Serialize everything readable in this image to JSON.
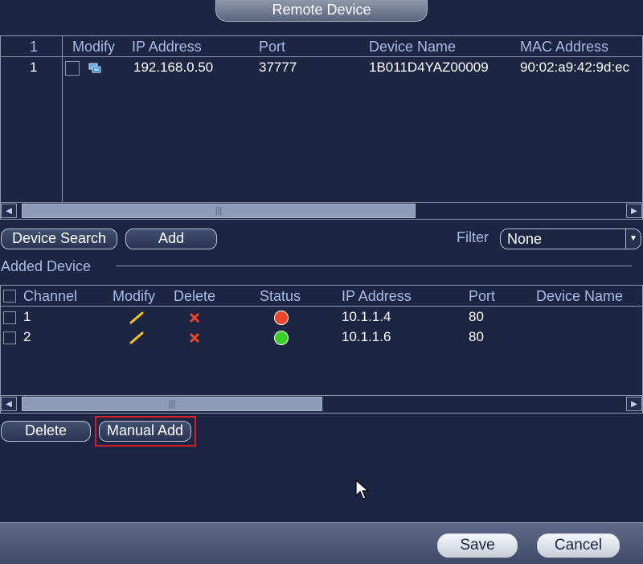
{
  "window": {
    "title": "Remote Device"
  },
  "search_table": {
    "columns": [
      "1",
      "Modify",
      "IP Address",
      "Port",
      "Device Name",
      "MAC Address"
    ],
    "rows": [
      {
        "num": "1",
        "ip": "192.168.0.50",
        "port": "37777",
        "device_name": "1B011D4YAZ00009",
        "mac": "90:02:a9:42:9d:ec"
      }
    ]
  },
  "search_buttons": {
    "device_search": "Device Search",
    "add": "Add"
  },
  "filter": {
    "label": "Filter",
    "value": "None"
  },
  "added_section": {
    "title": "Added Device"
  },
  "added_table": {
    "columns": [
      "Channel",
      "Modify",
      "Delete",
      "Status",
      "IP Address",
      "Port",
      "Device Name"
    ],
    "rows": [
      {
        "channel": "1",
        "status": "offline",
        "status_color": "#e8452a",
        "ip": "10.1.1.4",
        "port": "80"
      },
      {
        "channel": "2",
        "status": "online",
        "status_color": "#3ccf2a",
        "ip": "10.1.1.6",
        "port": "80"
      }
    ]
  },
  "added_buttons": {
    "delete": "Delete",
    "manual_add": "Manual Add"
  },
  "footer": {
    "save": "Save",
    "cancel": "Cancel"
  },
  "colors": {
    "background": "#1c2541",
    "header_text": "#a9bce6",
    "highlight": "#d2202a"
  }
}
